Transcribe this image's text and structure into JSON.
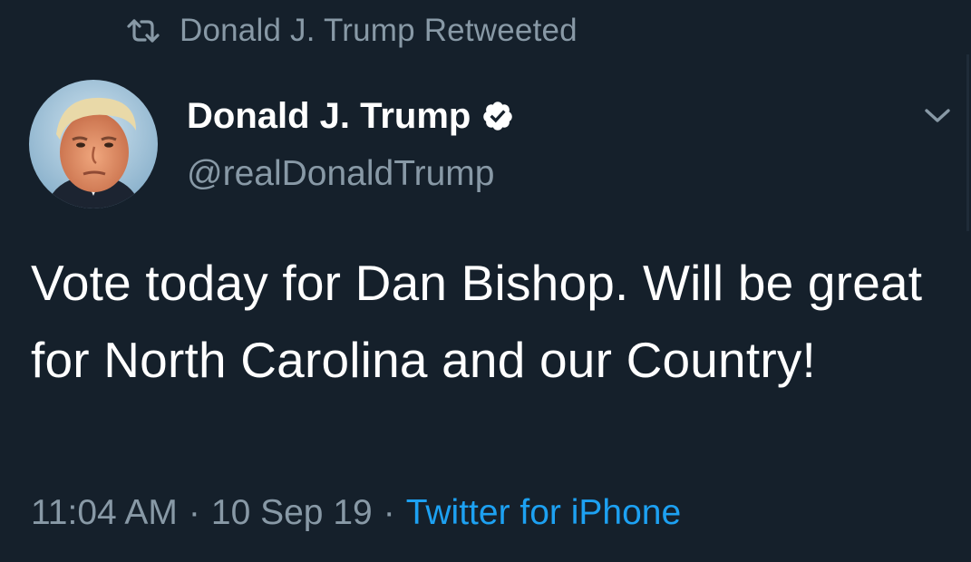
{
  "social_context": {
    "icon": "retweet-icon",
    "text": "Donald J. Trump Retweeted"
  },
  "author": {
    "display_name": "Donald J. Trump",
    "handle": "@realDonaldTrump",
    "verified_icon": "verified-badge-icon",
    "avatar": "profile-photo"
  },
  "menu": {
    "icon": "chevron-down-icon"
  },
  "tweet": {
    "text": "Vote today for Dan Bishop. Will be great for North Carolina and our Country!"
  },
  "meta": {
    "time": "11:04 AM",
    "separator": "·",
    "date": "10 Sep 19",
    "source": "Twitter for iPhone"
  },
  "colors": {
    "background": "#15202b",
    "primary_text": "#ffffff",
    "secondary_text": "#8899a6",
    "accent": "#1da1f2"
  }
}
